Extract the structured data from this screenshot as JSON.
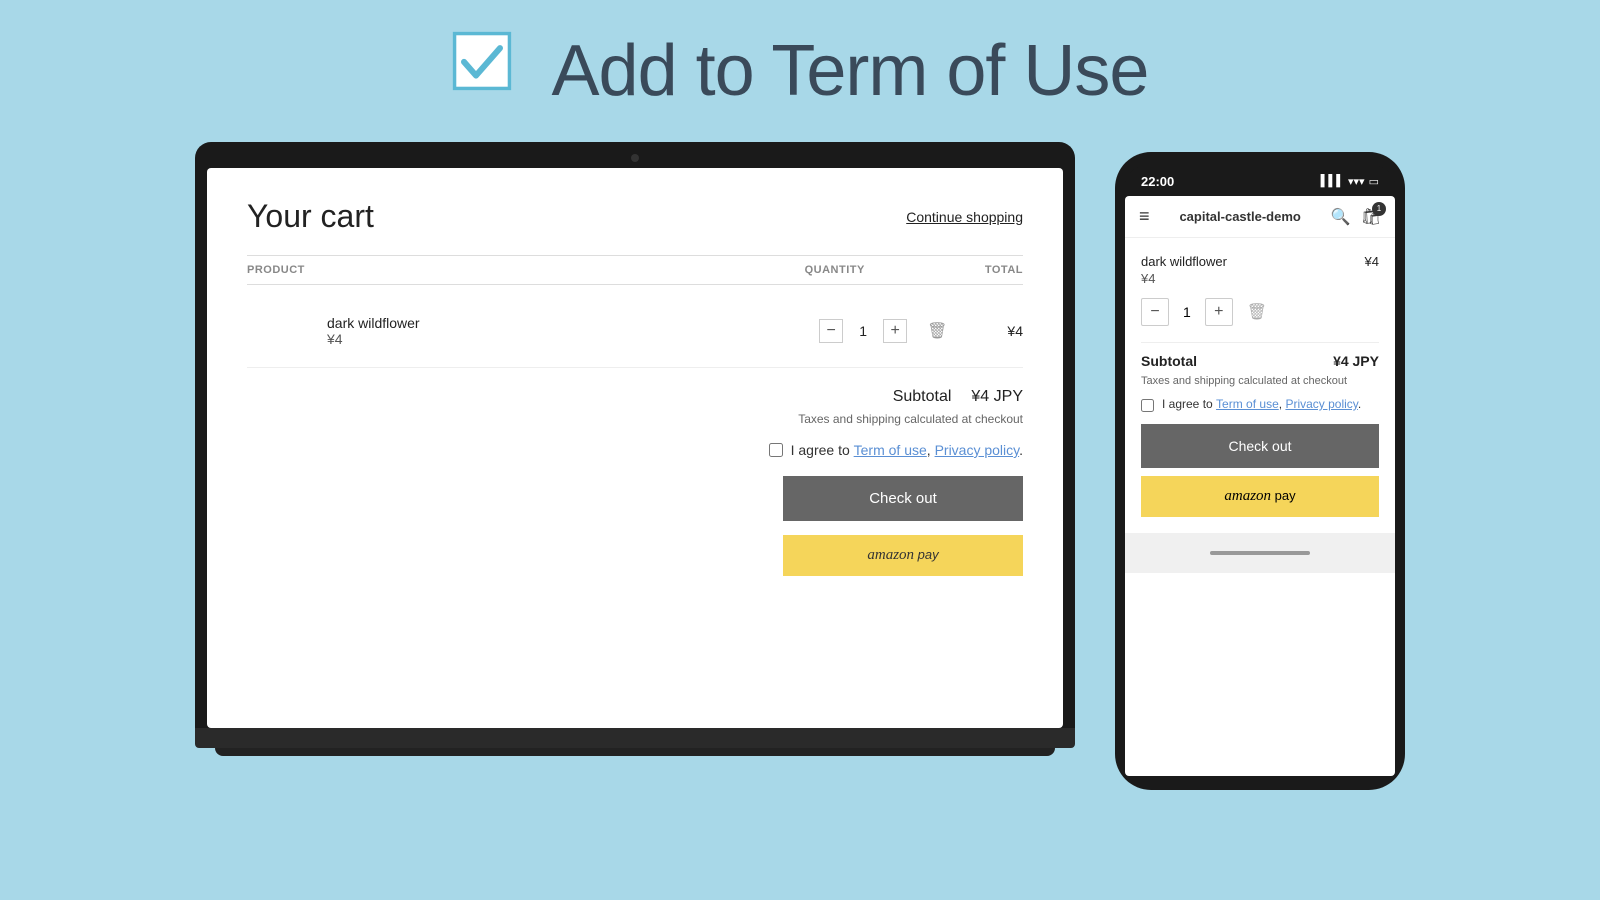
{
  "header": {
    "title": "Add to Term of Use",
    "checkmark_alt": "checkmark icon"
  },
  "laptop": {
    "cart": {
      "title": "Your cart",
      "continue_shopping": "Continue shopping",
      "columns": {
        "product": "PRODUCT",
        "quantity": "QUANTITY",
        "total": "TOTAL"
      },
      "item": {
        "name": "dark wildflower",
        "price": "¥4",
        "quantity": "1",
        "total": "¥4"
      },
      "subtotal_label": "Subtotal",
      "subtotal_value": "¥4 JPY",
      "taxes_note": "Taxes and shipping calculated at checkout",
      "terms_text": "I agree to",
      "term_of_use": "Term of use",
      "privacy_policy": "Privacy policy",
      "terms_separator": ",",
      "terms_end": ".",
      "checkout_label": "Check out",
      "amazon_pay_label": "amazon pay"
    }
  },
  "phone": {
    "status_bar": {
      "time": "22:00",
      "signal": "▌▌▌",
      "wifi": "WiFi",
      "battery": "🔋"
    },
    "nav": {
      "menu_icon": "≡",
      "store_name": "capital-castle-demo",
      "search_icon": "🔍",
      "cart_icon": "🛍",
      "cart_badge": "1"
    },
    "cart": {
      "item": {
        "name": "dark wildflower",
        "price": "¥4",
        "sub_price": "¥4",
        "quantity": "1"
      },
      "subtotal_label": "Subtotal",
      "subtotal_value": "¥4 JPY",
      "taxes_note": "Taxes and shipping calculated at checkout",
      "terms_text": "I agree to",
      "term_of_use": "Term of use",
      "privacy_policy": "Privacy policy",
      "terms_separator": ",",
      "terms_end": ".",
      "checkout_label": "Check out",
      "amazon_pay_label": "amazon pay"
    }
  },
  "colors": {
    "background": "#a8d8e8",
    "checkout_btn": "#666666",
    "amazon_btn": "#f5d55a",
    "link": "#5a8fd4",
    "title": "#3a4a5a"
  }
}
